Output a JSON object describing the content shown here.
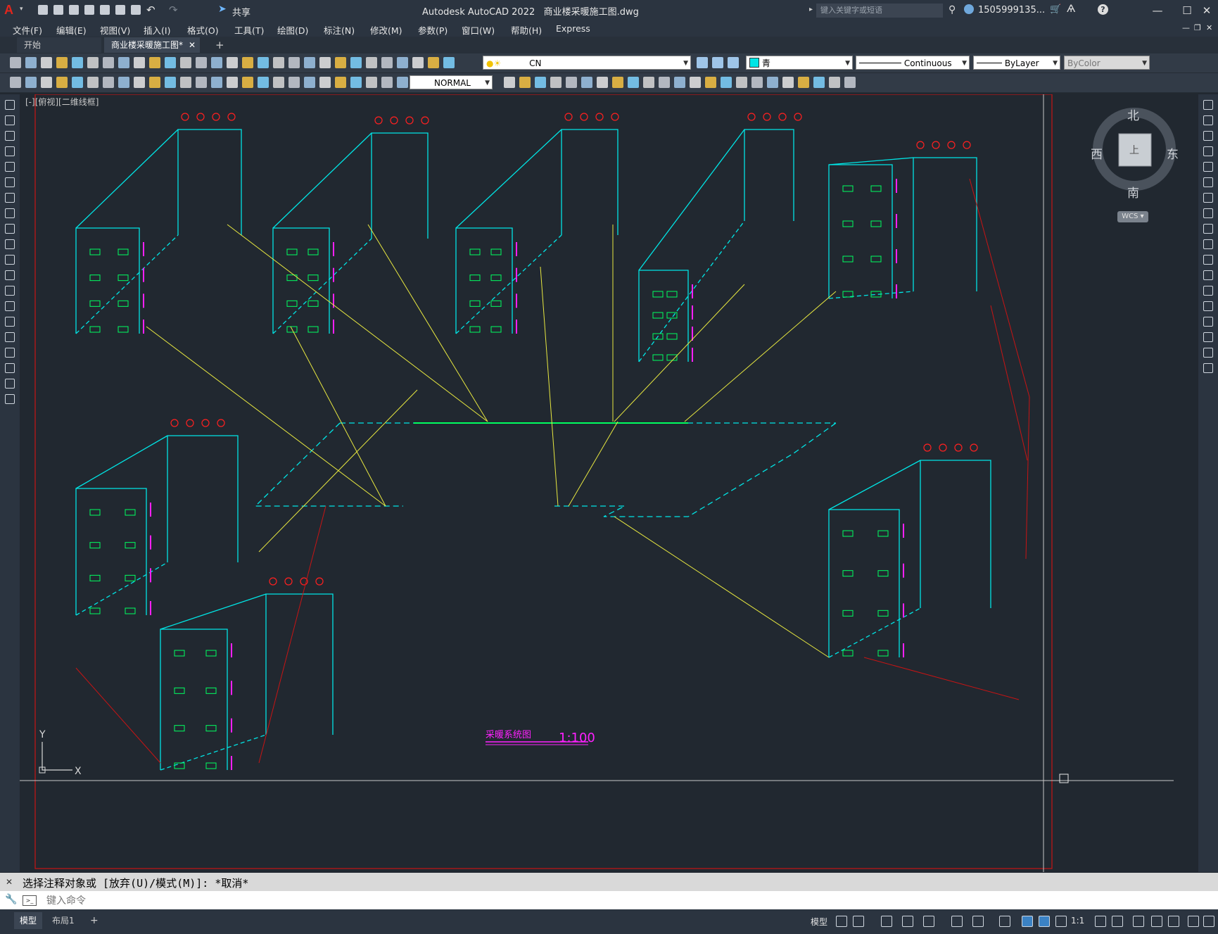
{
  "app": {
    "product": "Autodesk AutoCAD 2022",
    "filename": "商业楼采暖施工图.dwg",
    "search_placeholder": "键入关键字或短语",
    "user": "1505999135...",
    "share_label": "共享"
  },
  "menu": [
    "文件(F)",
    "编辑(E)",
    "视图(V)",
    "插入(I)",
    "格式(O)",
    "工具(T)",
    "绘图(D)",
    "标注(N)",
    "修改(M)",
    "参数(P)",
    "窗口(W)",
    "帮助(H)",
    "Express"
  ],
  "tabs": {
    "start": "开始",
    "current": "商业楼采暖施工图*"
  },
  "toolbar": {
    "layer": "CN",
    "color": "青",
    "linetype": "Continuous",
    "lineweight": "ByLayer",
    "plotstyle": "ByColor",
    "textstyle": "NORMAL"
  },
  "viewport": {
    "label": "[-][俯视][二维线框]"
  },
  "viewcube": {
    "north": "北",
    "south": "南",
    "east": "东",
    "west": "西",
    "ucs": "WCS"
  },
  "ucs_icon": {
    "x": "X",
    "y": "Y"
  },
  "drawing": {
    "title": "采暖系统图",
    "scale": "1:100",
    "colors": {
      "pipe": "#00e5e5",
      "leader": "#e8e840",
      "border": "#c81414",
      "label": "#ff20ff",
      "radiator": "#00ff60",
      "valve": "#ff2020"
    }
  },
  "command": {
    "history": "选择注释对象或 [放弃(U)/模式(M)]: *取消*",
    "placeholder": "键入命令"
  },
  "status": {
    "model_tab": "模型",
    "layout_tab": "布局1",
    "model_label": "模型",
    "scale": "1:1"
  }
}
